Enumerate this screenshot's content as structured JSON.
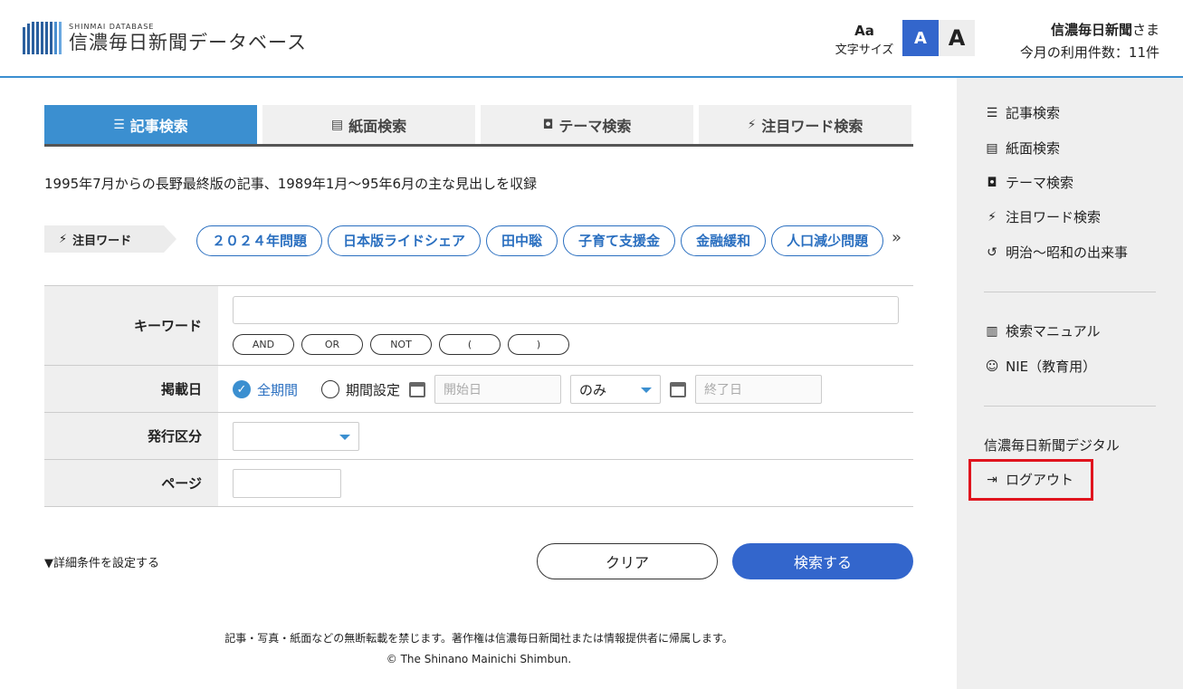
{
  "header": {
    "logo_sub": "SHINMAI DATABASE",
    "logo_main": "信濃毎日新聞データベース",
    "fontsize_icon": "Aa",
    "fontsize_label": "文字サイズ",
    "font_small": "A",
    "font_large": "A",
    "user_name": "信濃毎日新聞",
    "user_suffix": "さま",
    "usage": "今月の利用件数：11件"
  },
  "tabs": [
    {
      "icon": "☰",
      "label": "記事検索"
    },
    {
      "icon": "▤",
      "label": "紙面検索"
    },
    {
      "icon": "◘",
      "label": "テーマ検索"
    },
    {
      "icon": "⚡",
      "label": "注目ワード検索"
    }
  ],
  "description": "1995年7月からの長野最終版の記事、1989年1月～95年6月の主な見出しを収録",
  "trending": {
    "icon": "⚡",
    "label": "注目ワード",
    "chips": [
      "２０２４年問題",
      "日本版ライドシェア",
      "田中聡",
      "子育て支援金",
      "金融緩和",
      "人口減少問題"
    ],
    "more": "»"
  },
  "form": {
    "keyword_label": "キーワード",
    "operators": [
      "AND",
      "OR",
      "NOT",
      "(",
      ")"
    ],
    "date_label": "掲載日",
    "radio_all": "全期間",
    "radio_range": "期間設定",
    "start_placeholder": "開始日",
    "range_select": "のみ",
    "end_placeholder": "終了日",
    "issue_label": "発行区分",
    "issue_value": "",
    "page_label": "ページ"
  },
  "actions": {
    "detail": "▼詳細条件を設定する",
    "clear": "クリア",
    "search": "検索する"
  },
  "footer": {
    "notice": "記事・写真・紙面などの無断転載を禁じます。著作権は信濃毎日新聞社または情報提供者に帰属します。",
    "copyright": "© The Shinano Mainichi Shimbun."
  },
  "sidebar": {
    "items": [
      {
        "icon": "☰",
        "label": "記事検索"
      },
      {
        "icon": "▤",
        "label": "紙面検索"
      },
      {
        "icon": "◘",
        "label": "テーマ検索"
      },
      {
        "icon": "⚡",
        "label": "注目ワード検索"
      },
      {
        "icon": "↺",
        "label": "明治～昭和の出来事"
      }
    ],
    "manual": {
      "icon": "▥",
      "label": "検索マニュアル"
    },
    "nie": {
      "icon": "☺",
      "label": "NIE（教育用）"
    },
    "digital": "信濃毎日新聞デジタル",
    "logout": {
      "icon": "⇥",
      "label": "ログアウト"
    }
  },
  "colors": {
    "accent": "#3b8fd0",
    "primary_button": "#3366cc",
    "chip": "#2a6fc0",
    "highlight": "#e0141e"
  }
}
